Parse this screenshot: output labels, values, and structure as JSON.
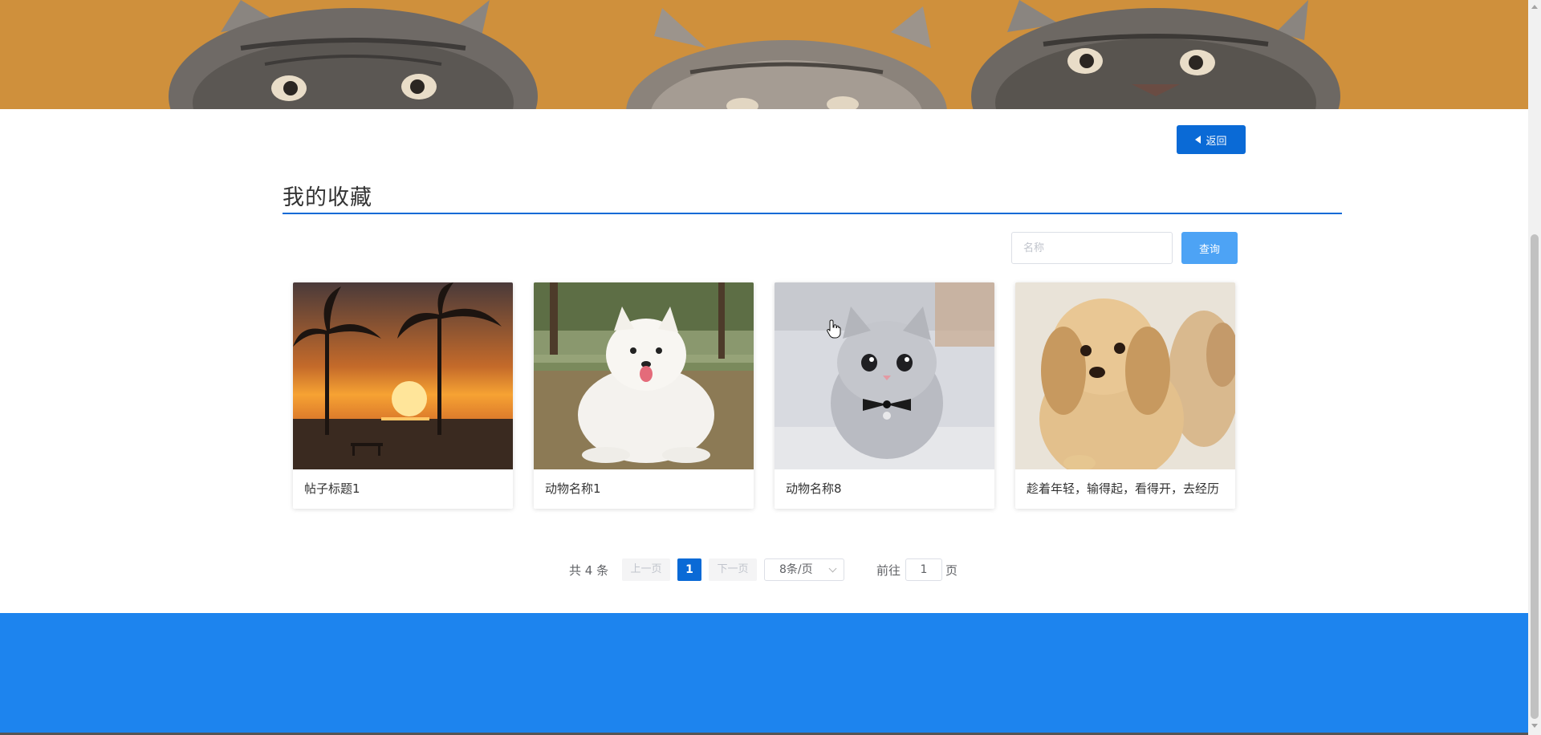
{
  "header": {
    "back_label": "返回"
  },
  "section": {
    "title": "我的收藏"
  },
  "search": {
    "placeholder": "名称",
    "value": "",
    "button_label": "查询"
  },
  "cards": [
    {
      "caption": "帖子标题1",
      "image": "sunset-palm-trees"
    },
    {
      "caption": "动物名称1",
      "image": "white-samoyed-dog"
    },
    {
      "caption": "动物名称8",
      "image": "grey-kitten-bow-tie"
    },
    {
      "caption": "趁着年轻，输得起，看得开，去经历",
      "image": "golden-puppies"
    }
  ],
  "pagination": {
    "total_text": "共 4 条",
    "prev_label": "上一页",
    "current_page": "1",
    "next_label": "下一页",
    "page_size": "8条/页",
    "goto_label": "前往",
    "goto_value": "1",
    "goto_unit": "页"
  },
  "colors": {
    "primary": "#0a6ad6",
    "search_button": "#4da3f5",
    "footer": "#1d84ee",
    "banner_bg": "#d4953f"
  },
  "icons": {
    "back": "caret-left-icon",
    "page_size_dropdown": "chevron-down-icon"
  }
}
